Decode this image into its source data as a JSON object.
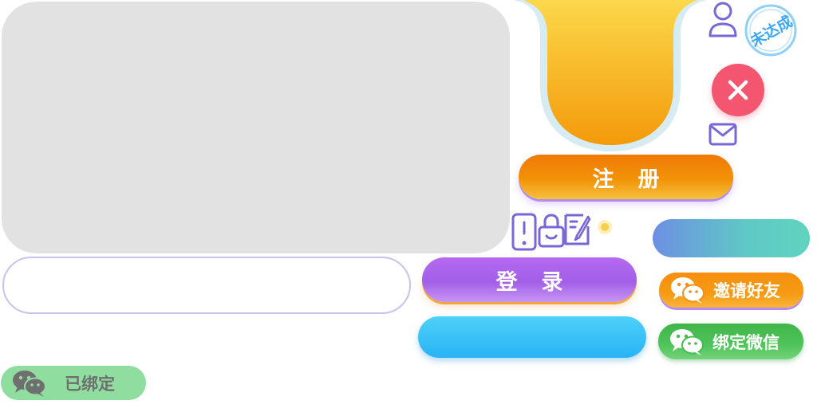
{
  "buttons": {
    "register_label": "注册",
    "login_label": "登录",
    "invite_label": "邀请好友",
    "bind_wechat_label": "绑定微信",
    "bound_label": "已绑定"
  },
  "stamp": {
    "text": "未达成"
  },
  "icons": {
    "user": "user-icon",
    "mail": "mail-icon",
    "close": "close-icon",
    "phone": "phone-icon",
    "lock": "lock-icon",
    "edit": "edit-icon",
    "wechat": "wechat-icon",
    "sparkle": "sparkle-icon"
  },
  "colors": {
    "panel": "#e2e2e2",
    "register": "#f0800a",
    "login": "#a962ee",
    "blue_button": "#2cb6f5",
    "teal_button": "#5fd3c0",
    "invite": "#f68f12",
    "bind_wechat": "#46bb50",
    "bound": "#8fde9f",
    "close": "#f4566f",
    "stamp": "#3da7f4",
    "icon_purple": "#7a66d6",
    "shield_gold": "#f9c939"
  }
}
